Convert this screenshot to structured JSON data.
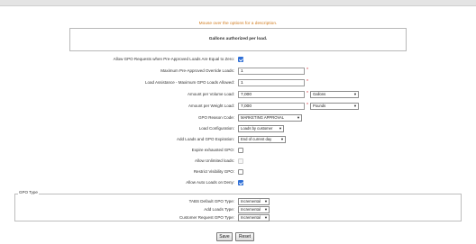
{
  "hint": "Mouse over the options for a description.",
  "description": "Gallons authorized per load.",
  "rows": [
    {
      "label": "Allow GPO Requests when Pre-Approved Loads Are Equal to Zero:",
      "checked": true
    },
    {
      "label": "Maximum Pre-Approved Override Loads:",
      "value": "1"
    },
    {
      "label": "Load Assistance - Maximum GPO Loads Allowed:",
      "value": "1"
    },
    {
      "label": "Amount per Volume Load:",
      "value": "7,000",
      "unit": "Gallons"
    },
    {
      "label": "Amount per Weight Load:",
      "value": "7,000",
      "unit": "Pounds"
    },
    {
      "label": "GPO Reason Code:",
      "select": "MARKETING APPROVAL"
    },
    {
      "label": "Load Configuration:",
      "select": "Loads by customer"
    },
    {
      "label": "Add Loads and GPO Expiration:",
      "select": "End of current day"
    },
    {
      "label": "Expire exhausted GPO:",
      "checked": false
    },
    {
      "label": "Allow Unlimited loads:",
      "checked": false
    },
    {
      "label": "Restrict Visibility GPO:",
      "checked": false
    },
    {
      "label": "Allow Auto Loads on Deny:",
      "checked": true
    }
  ],
  "gpo_type": {
    "legend": "GPO Type",
    "rows": [
      {
        "label": "TABS Default GPO Type:",
        "select": "Incremental"
      },
      {
        "label": "Add Loads Type:",
        "select": "Incremental"
      },
      {
        "label": "Customer Request GPO Type:",
        "select": "Incremental"
      }
    ]
  },
  "buttons": {
    "save": "Save",
    "reset": "Reset"
  },
  "colors": {
    "accent": "#2f6fd6",
    "required": "#d4303a",
    "hint": "#d07a1c"
  }
}
